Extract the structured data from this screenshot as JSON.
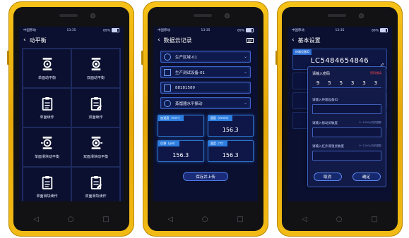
{
  "status_bar": {
    "carrier": "中国移动",
    "time": "13:35",
    "battery": "89%"
  },
  "screen1": {
    "title": "动平衡",
    "items": [
      {
        "label": "单面动平衡",
        "icon": "single-plane-balance-icon"
      },
      {
        "label": "双面动平衡",
        "icon": "dual-plane-balance-icon"
      },
      {
        "label": "单面续作",
        "icon": "single-plane-resume-icon"
      },
      {
        "label": "双面续作",
        "icon": "dual-plane-resume-icon"
      },
      {
        "label": "单面滑块动平衡",
        "icon": "single-plane-slider-balance-icon"
      },
      {
        "label": "双面滑块动平衡",
        "icon": "dual-plane-slider-balance-icon"
      },
      {
        "label": "单面滑块续作",
        "icon": "single-plane-slider-resume-icon"
      },
      {
        "label": "双面滑块续作",
        "icon": "dual-plane-slider-resume-icon"
      }
    ]
  },
  "screen2": {
    "title": "数据云记录",
    "fields": [
      {
        "value": "生产区域-01",
        "icon": "area-icon"
      },
      {
        "value": "生产测试设备-01",
        "icon": "device-icon"
      },
      {
        "value": "88181589",
        "icon": "id-icon"
      },
      {
        "value": "蒸馏器水平振动",
        "icon": "measure-point-icon"
      }
    ],
    "measurements": [
      {
        "label": "加速度（m/s²）",
        "value": ""
      },
      {
        "label": "速度（mm/s）",
        "value": "156.3"
      },
      {
        "label": "位移（μm）",
        "value": "156.3"
      },
      {
        "label": "温度（℃）",
        "value": "156.3"
      }
    ],
    "save_label": "保存并上传"
  },
  "screen3": {
    "title": "基本设置",
    "device_tag": "终端设备ID",
    "device_id": "LC5484654846",
    "dialog": {
      "password_label": "请输入密码",
      "password_error": "密码错误",
      "digits": [
        "9",
        "5",
        "5",
        "3",
        "3",
        "3"
      ],
      "terminal_label": "请输入终端设备ID",
      "vibration_label": "请输入振动灵敏度",
      "vibration_hint": "0~1200以内的整数",
      "infrared_label": "请输入红外测温灵敏度",
      "infrared_hint": "0~1200以内的整数",
      "cancel_label": "取消",
      "confirm_label": "确定"
    }
  },
  "nav": {
    "back": "◁",
    "home": "○",
    "recent": "□"
  }
}
